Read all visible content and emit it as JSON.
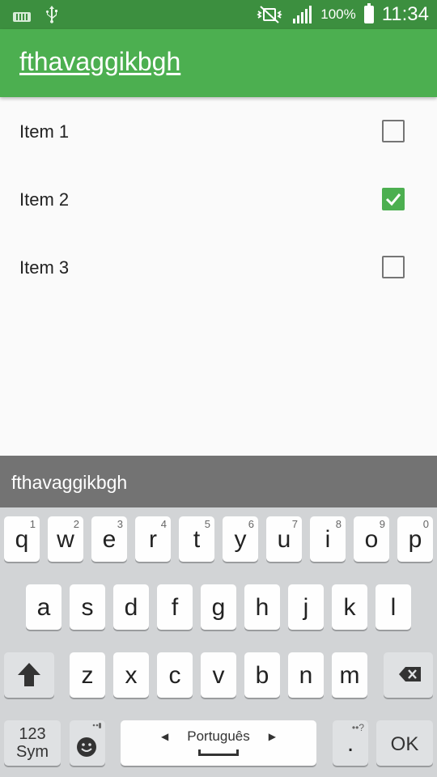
{
  "status_bar": {
    "battery": "100%",
    "time": "11:34"
  },
  "app": {
    "title": "fthavaggikbgh"
  },
  "list": {
    "items": [
      {
        "label": "Item 1",
        "checked": false
      },
      {
        "label": "Item 2",
        "checked": true
      },
      {
        "label": "Item 3",
        "checked": false
      }
    ]
  },
  "colors": {
    "accent": "#4caf50",
    "status_bar": "#3c8f3f",
    "suggestion_strip": "#737373"
  },
  "keyboard": {
    "suggestion": "fthavaggikbgh",
    "row1": [
      {
        "ch": "q",
        "hint": "1"
      },
      {
        "ch": "w",
        "hint": "2"
      },
      {
        "ch": "e",
        "hint": "3"
      },
      {
        "ch": "r",
        "hint": "4"
      },
      {
        "ch": "t",
        "hint": "5"
      },
      {
        "ch": "y",
        "hint": "6"
      },
      {
        "ch": "u",
        "hint": "7"
      },
      {
        "ch": "i",
        "hint": "8"
      },
      {
        "ch": "o",
        "hint": "9"
      },
      {
        "ch": "p",
        "hint": "0"
      }
    ],
    "row2": [
      "a",
      "s",
      "d",
      "f",
      "g",
      "h",
      "j",
      "k",
      "l"
    ],
    "row3": [
      "z",
      "x",
      "c",
      "v",
      "b",
      "n",
      "m"
    ],
    "sym_top": "123",
    "sym_bottom": "Sym",
    "language": "Português",
    "period": ".",
    "period_hint": "••?",
    "ok": "OK",
    "icons": {
      "shift": "shift-arrow-icon",
      "backspace": "backspace-icon",
      "emoji": "smiley-icon"
    }
  }
}
